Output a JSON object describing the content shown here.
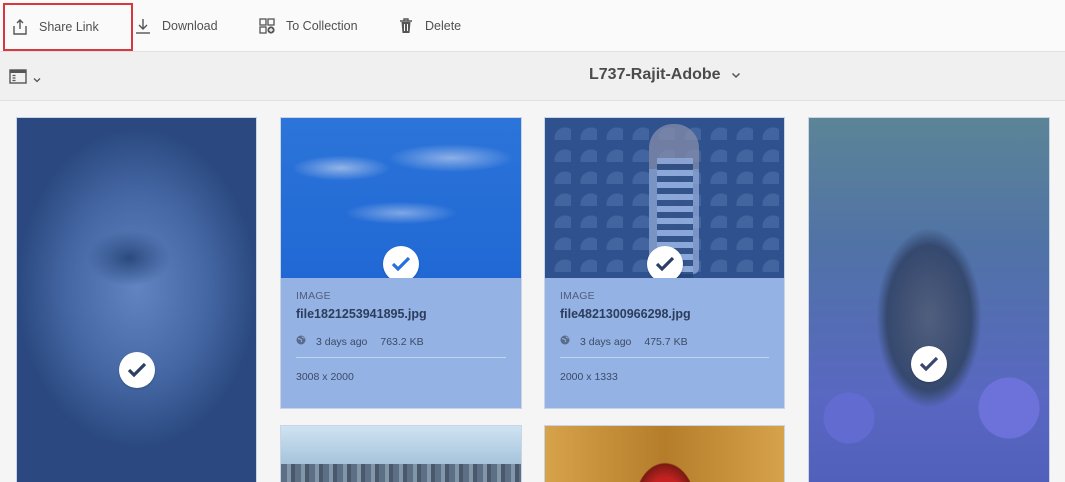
{
  "toolbar": {
    "share_label": "Share Link",
    "download_label": "Download",
    "collection_label": "To Collection",
    "delete_label": "Delete"
  },
  "header": {
    "folder_title": "L737-Rajit-Adobe"
  },
  "assets": [
    {
      "type": "IMAGE",
      "file": "file1821253941895.jpg",
      "modified": "3 days ago",
      "size": "763.2 KB",
      "dimensions": "3008 x 2000"
    },
    {
      "type": "IMAGE",
      "file": "file4821300966298.jpg",
      "modified": "3 days ago",
      "size": "475.7 KB",
      "dimensions": "2000 x 1333"
    }
  ],
  "colors": {
    "selection_overlay": "#2a66d0",
    "highlight_border": "#d7373f",
    "meta_panel": "#94b2e4"
  }
}
